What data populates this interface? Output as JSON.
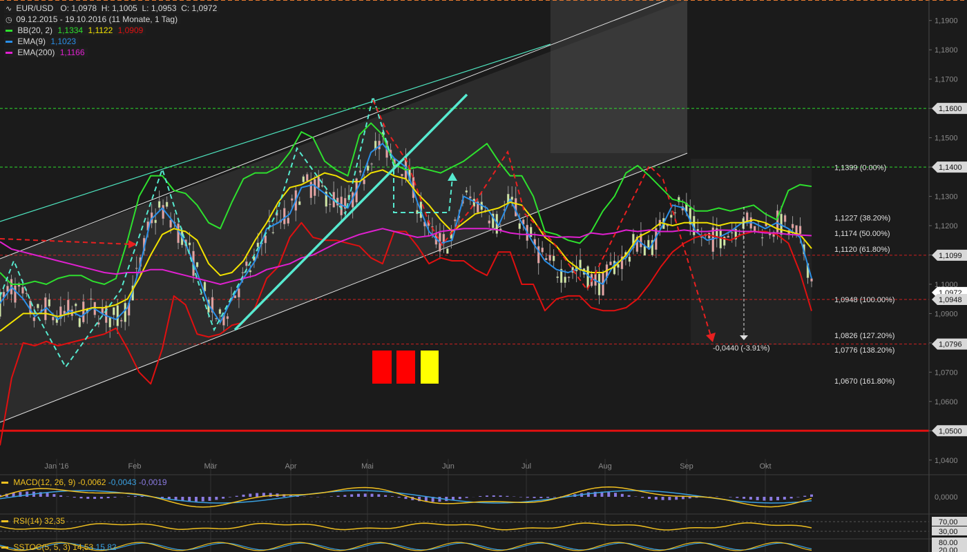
{
  "header": {
    "symbol": "EUR/USD",
    "ohlc": {
      "o": "O: 1,0978",
      "h": "H: 1,1005",
      "l": "L: 1,0953",
      "c": "C: 1,0972"
    },
    "range": "09.12.2015 - 19.10.2016 (11 Monate, 1 Tag)",
    "indicators": [
      {
        "label": "BB(20, 2)",
        "values": [
          "1,1334",
          "1,1122",
          "1,0909"
        ],
        "colors": [
          "#2ee02e",
          "#f2e200",
          "#e01010"
        ]
      },
      {
        "label": "EMA(9)",
        "values": [
          "1,1023"
        ],
        "colors": [
          "#2a8fe8"
        ]
      },
      {
        "label": "EMA(200)",
        "values": [
          "1,1166"
        ],
        "colors": [
          "#e020d0"
        ]
      }
    ]
  },
  "chart_data": {
    "type": "line",
    "title": "EUR/USD",
    "date_range": "09.12.2015 - 19.10.2016",
    "ylim": [
      1.035,
      1.197
    ],
    "y_ticks": [
      "1,1900",
      "1,1800",
      "1,1700",
      "1,1600",
      "1,1500",
      "1,1400",
      "1,1300",
      "1,1200",
      "1,1100",
      "1,1000",
      "1,0900",
      "1,0800",
      "1,0700",
      "1,0600",
      "1,0500",
      "1,0400"
    ],
    "x_ticks": [
      "Jan '16",
      "Feb",
      "Mär",
      "Apr",
      "Mai",
      "Jun",
      "Jul",
      "Aug",
      "Sep",
      "Okt"
    ],
    "price_labels": [
      {
        "text": "1,1600",
        "value": 1.16
      },
      {
        "text": "1,1400",
        "value": 1.14
      },
      {
        "text": "1,1099",
        "value": 1.1099
      },
      {
        "text": "1,0972",
        "value": 1.0972,
        "highlight": true
      },
      {
        "text": "1,0948",
        "value": 1.0948
      },
      {
        "text": "1,0796",
        "value": 1.0796
      },
      {
        "text": "1,0500",
        "value": 1.05
      }
    ],
    "fibonacci": [
      {
        "text": "1,1399 (0.00%)",
        "value": 1.1399
      },
      {
        "text": "1,1227 (38.20%)",
        "value": 1.1227
      },
      {
        "text": "1,1174 (50.00%)",
        "value": 1.1174
      },
      {
        "text": "1,1120 (61.80%)",
        "value": 1.112
      },
      {
        "text": "1,0948 (100.00%)",
        "value": 1.0948
      },
      {
        "text": "1,0826 (127.20%)",
        "value": 1.0826
      },
      {
        "text": "1,0776 (138.20%)",
        "value": 1.0776
      },
      {
        "text": "1,0670 (161.80%)",
        "value": 1.067
      }
    ],
    "measurement": "-0,0440 (-3.91%)",
    "series": [
      {
        "name": "EMA(9)",
        "color": "#2a8fe8",
        "values": [
          1.0935,
          1.099,
          1.095,
          1.089,
          1.092,
          1.088,
          1.091,
          1.089,
          1.092,
          1.0895,
          1.088,
          1.092,
          1.105,
          1.122,
          1.126,
          1.121,
          1.114,
          1.104,
          1.093,
          1.087,
          1.095,
          1.102,
          1.108,
          1.119,
          1.121,
          1.124,
          1.133,
          1.134,
          1.131,
          1.128,
          1.126,
          1.134,
          1.145,
          1.148,
          1.143,
          1.14,
          1.128,
          1.118,
          1.114,
          1.115,
          1.13,
          1.128,
          1.126,
          1.12,
          1.129,
          1.121,
          1.114,
          1.108,
          1.105,
          1.104,
          1.1055,
          1.102,
          1.1,
          1.107,
          1.109,
          1.115,
          1.112,
          1.119,
          1.127,
          1.126,
          1.118,
          1.115,
          1.116,
          1.118,
          1.121,
          1.121,
          1.119,
          1.121,
          1.119,
          1.116,
          1.102
        ]
      },
      {
        "name": "BB upper",
        "color": "#2ee02e",
        "values": [
          1.104,
          1.1,
          1.1,
          1.101,
          1.1,
          1.102,
          1.103,
          1.103,
          1.101,
          1.1,
          1.102,
          1.115,
          1.13,
          1.137,
          1.137,
          1.132,
          1.131,
          1.127,
          1.121,
          1.119,
          1.128,
          1.136,
          1.138,
          1.138,
          1.14,
          1.145,
          1.152,
          1.15,
          1.142,
          1.139,
          1.137,
          1.151,
          1.155,
          1.151,
          1.141,
          1.139,
          1.14,
          1.139,
          1.138,
          1.14,
          1.142,
          1.145,
          1.148,
          1.142,
          1.137,
          1.137,
          1.13,
          1.118,
          1.117,
          1.115,
          1.114,
          1.118,
          1.125,
          1.13,
          1.138,
          1.1405,
          1.137,
          1.133,
          1.129,
          1.128,
          1.125,
          1.125,
          1.126,
          1.125,
          1.126,
          1.127,
          1.124,
          1.122,
          1.132,
          1.134,
          1.1334
        ]
      },
      {
        "name": "BB middle",
        "color": "#f2e200",
        "values": [
          1.084,
          1.087,
          1.09,
          1.09,
          1.09,
          1.089,
          1.09,
          1.091,
          1.092,
          1.092,
          1.093,
          1.095,
          1.102,
          1.11,
          1.117,
          1.119,
          1.118,
          1.115,
          1.107,
          1.103,
          1.104,
          1.108,
          1.115,
          1.121,
          1.128,
          1.133,
          1.134,
          1.136,
          1.138,
          1.137,
          1.135,
          1.135,
          1.138,
          1.139,
          1.137,
          1.136,
          1.131,
          1.127,
          1.122,
          1.118,
          1.121,
          1.124,
          1.125,
          1.126,
          1.128,
          1.127,
          1.122,
          1.116,
          1.113,
          1.108,
          1.105,
          1.104,
          1.104,
          1.106,
          1.11,
          1.116,
          1.118,
          1.121,
          1.12,
          1.121,
          1.121,
          1.121,
          1.12,
          1.121,
          1.121,
          1.122,
          1.121,
          1.119,
          1.118,
          1.117,
          1.1122
        ]
      },
      {
        "name": "BB lower",
        "color": "#e01010",
        "values": [
          1.045,
          1.068,
          1.08,
          1.079,
          1.0805,
          1.079,
          1.08,
          1.081,
          1.082,
          1.083,
          1.085,
          1.078,
          1.07,
          1.066,
          1.078,
          1.096,
          1.093,
          1.083,
          1.082,
          1.083,
          1.086,
          1.087,
          1.092,
          1.102,
          1.106,
          1.116,
          1.121,
          1.116,
          1.115,
          1.115,
          1.114,
          1.113,
          1.109,
          1.107,
          1.118,
          1.118,
          1.113,
          1.107,
          1.109,
          1.108,
          1.108,
          1.105,
          1.103,
          1.111,
          1.111,
          1.1,
          1.1,
          1.091,
          1.095,
          1.096,
          1.096,
          1.092,
          1.091,
          1.091,
          1.092,
          1.095,
          1.1,
          1.106,
          1.111,
          1.114,
          1.116,
          1.117,
          1.116,
          1.115,
          1.117,
          1.118,
          1.118,
          1.117,
          1.114,
          1.104,
          1.0909
        ]
      },
      {
        "name": "EMA(200)",
        "color": "#e020d0",
        "values": [
          1.1145,
          1.112,
          1.111,
          1.11,
          1.109,
          1.108,
          1.107,
          1.106,
          1.105,
          1.104,
          1.1035,
          1.104,
          1.104,
          1.105,
          1.105,
          1.104,
          1.103,
          1.102,
          1.101,
          1.1,
          1.101,
          1.102,
          1.103,
          1.105,
          1.106,
          1.107,
          1.109,
          1.11,
          1.112,
          1.114,
          1.1155,
          1.117,
          1.118,
          1.119,
          1.118,
          1.117,
          1.116,
          1.1165,
          1.118,
          1.1185,
          1.119,
          1.119,
          1.119,
          1.1185,
          1.1175,
          1.117,
          1.117,
          1.1165,
          1.116,
          1.1162,
          1.116,
          1.1175,
          1.117,
          1.1175,
          1.1185,
          1.118,
          1.1185,
          1.118,
          1.118,
          1.1185,
          1.118,
          1.118,
          1.1185,
          1.1184,
          1.118,
          1.118,
          1.1175,
          1.1175,
          1.117,
          1.1168,
          1.1166
        ]
      }
    ]
  },
  "sub_panels": {
    "macd": {
      "label": "MACD(12, 26, 9)",
      "values": [
        "-0,0062",
        "-0,0043",
        "-0,0019"
      ],
      "zero_tick": "0,0000"
    },
    "rsi": {
      "label": "RSI(14)",
      "value": "32,35",
      "ticks": [
        "70,00",
        "30,00"
      ]
    },
    "sstoc": {
      "label": "SSTOC(5, 5, 3)",
      "values": [
        "14,53",
        "15,82"
      ],
      "ticks": [
        "80,00",
        "20,00"
      ]
    }
  }
}
